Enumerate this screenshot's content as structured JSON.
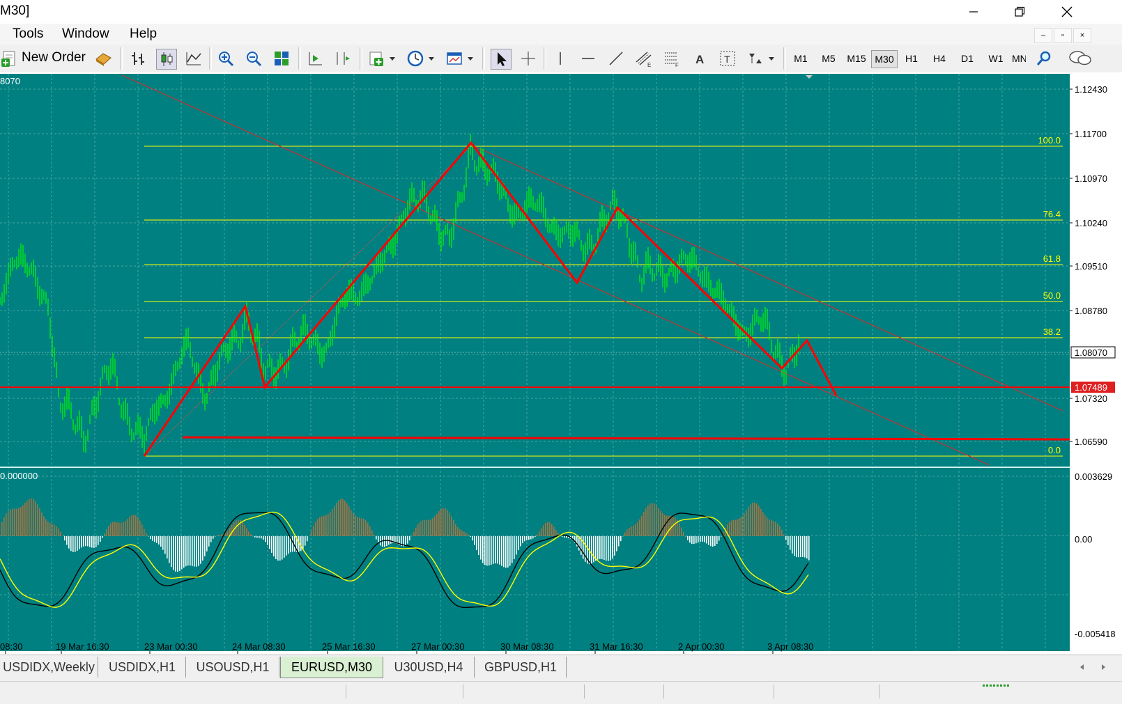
{
  "window": {
    "title": "M30]"
  },
  "menu": {
    "items": [
      "Tools",
      "Window",
      "Help"
    ]
  },
  "toolbar": {
    "new_order_label": "New Order",
    "timeframes": [
      "M1",
      "M5",
      "M15",
      "M30",
      "H1",
      "H4",
      "D1",
      "W1",
      "MN"
    ],
    "active_timeframe": "M30"
  },
  "chart": {
    "top_left_price": "8070",
    "price_axis": [
      "1.12430",
      "1.11700",
      "1.10970",
      "1.10240",
      "1.09510",
      "1.08780",
      "1.08070",
      "1.07489",
      "1.07320",
      "1.06590"
    ],
    "current_price": "1.08070",
    "red_line_price": "1.07489",
    "fib_levels": [
      "100.0",
      "76.4",
      "61.8",
      "50.0",
      "38.2",
      "0.0"
    ],
    "indicator_label": "0.000000",
    "indicator_axis": [
      "0.003629",
      "0.00",
      "-0.005418"
    ],
    "time_axis": [
      "08:30",
      "19 Mar 16:30",
      "23 Mar 00:30",
      "24 Mar 08:30",
      "25 Mar 16:30",
      "27 Mar 00:30",
      "30 Mar 08:30",
      "31 Mar 16:30",
      "2 Apr 00:30",
      "3 Apr 08:30"
    ],
    "colors": {
      "background": "#008080",
      "candles": "#00ff00",
      "fib": "#ffff00",
      "zigzag": "#ff0000",
      "histogram_up": "#b0703a",
      "histogram_down": "#ffffff"
    }
  },
  "tabs": [
    "USDIDX,Weekly",
    "USDIDX,H1",
    "USOUSD,H1",
    "EURUSD,M30",
    "U30USD,H4",
    "GBPUSD,H1"
  ],
  "active_tab": "EURUSD,M30"
}
